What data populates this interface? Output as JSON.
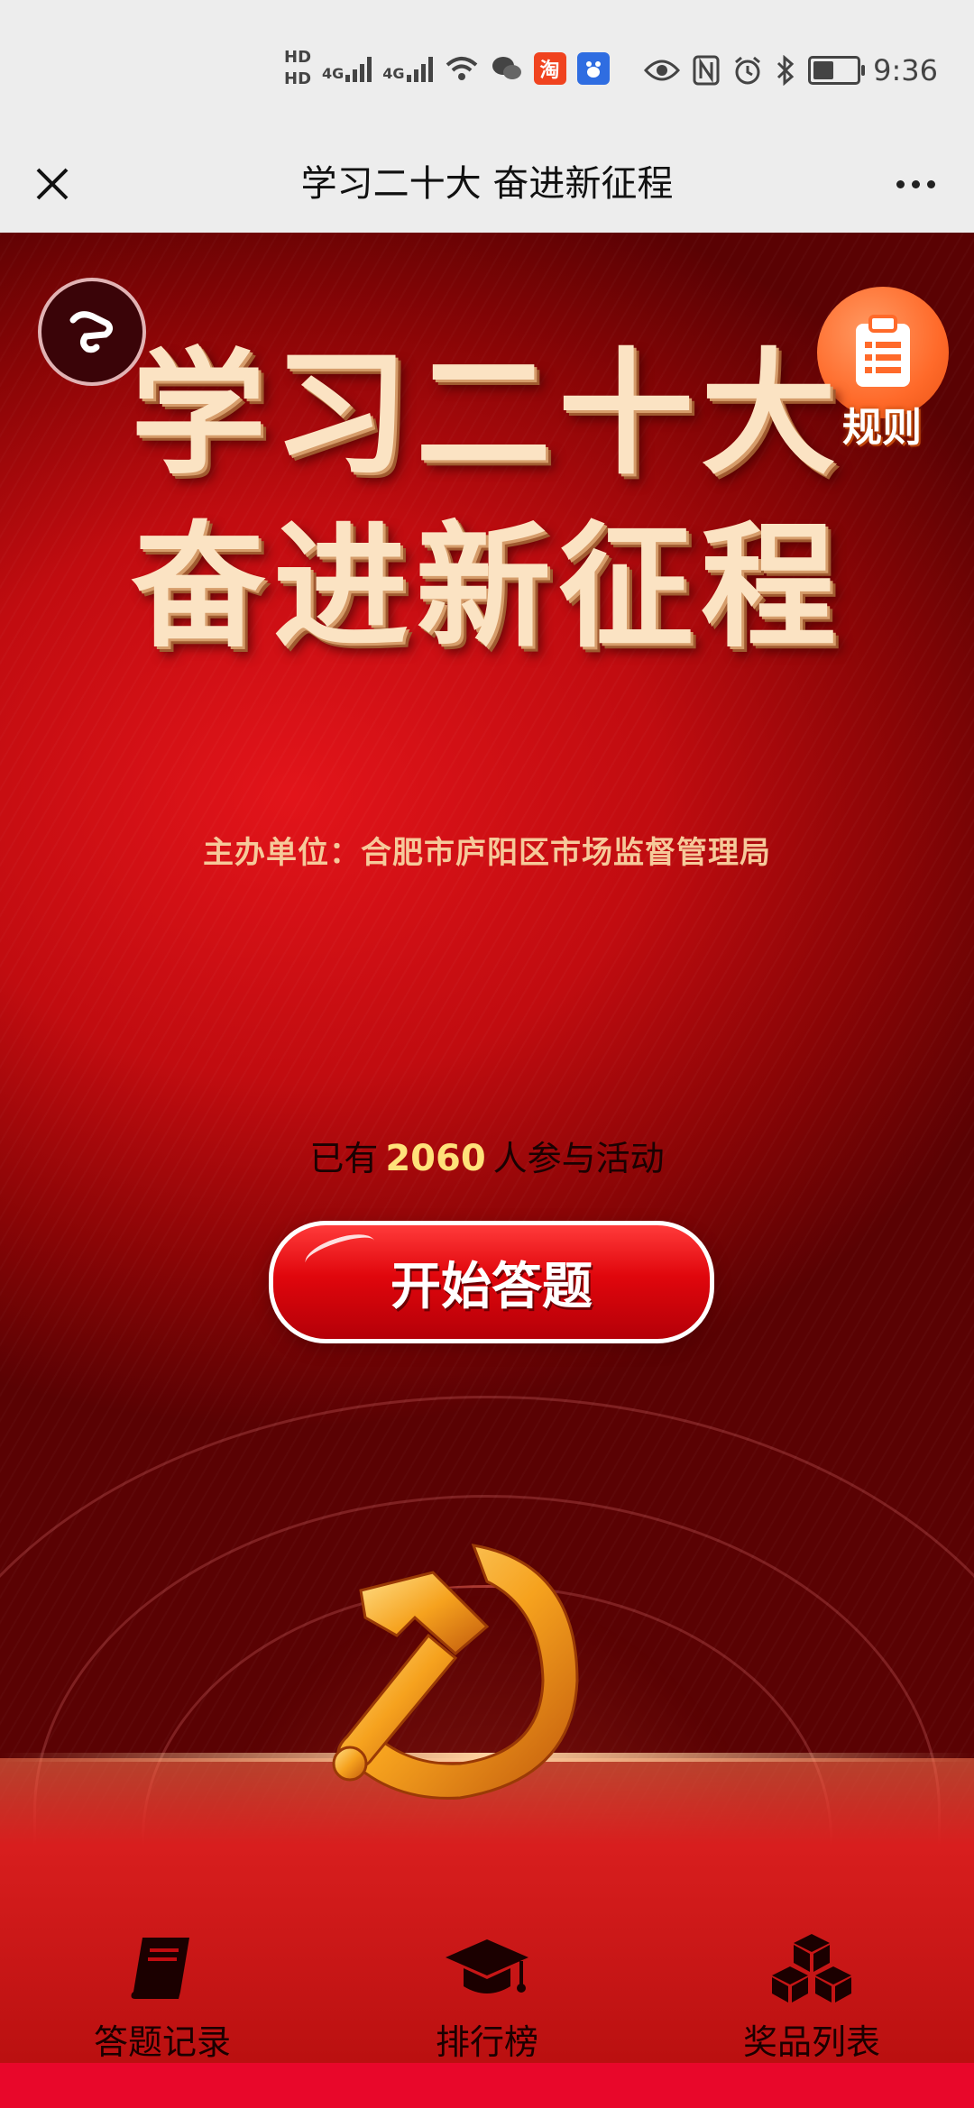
{
  "status_bar": {
    "hd1": "HD",
    "hd2": "HD",
    "net1": "4G",
    "net2": "4G",
    "taobao_badge": "淘",
    "time": "9:36",
    "battery_level": 0.5
  },
  "nav": {
    "title": "学习二十大 奋进新征程"
  },
  "hero": {
    "headline_line1": "学习二十大",
    "headline_line2": "奋进新征程",
    "sponsor": "主办单位：合肥市庐阳区市场监督管理局",
    "rule_label": "规则"
  },
  "participants": {
    "prefix": "已有",
    "count": "2060",
    "suffix": "人参与活动"
  },
  "start_button": {
    "label": "开始答题"
  },
  "tabs": [
    {
      "label": "答题记录",
      "icon": "book-icon"
    },
    {
      "label": "排行榜",
      "icon": "graduation-cap-icon"
    },
    {
      "label": "奖品列表",
      "icon": "boxes-icon"
    }
  ],
  "colors": {
    "primary_red": "#c10c10",
    "accent_orange": "#ff6a2a",
    "count_yellow": "#ffe27a",
    "headline_gold": "#fbe3c3"
  }
}
